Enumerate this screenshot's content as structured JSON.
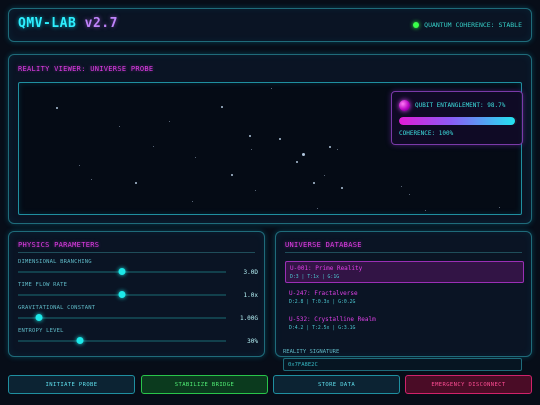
{
  "header": {
    "title": "QMV-LAB",
    "version": "v2.7",
    "status": "QUANTUM COHERENCE: STABLE",
    "status_color": "#39ff4a"
  },
  "viewer": {
    "title": "REALITY VIEWER: UNIVERSE PROBE",
    "qubit": {
      "entanglement_label": "QUBIT ENTANGLEMENT: 98.7%",
      "entanglement_fraction": 0.987,
      "coherence_label": "COHERENCE: 100%"
    }
  },
  "physics": {
    "title": "PHYSICS PARAMETERS",
    "params": [
      {
        "label": "DIMENSIONAL BRANCHING",
        "value": "3.0D",
        "fraction": 0.5
      },
      {
        "label": "TIME FLOW RATE",
        "value": "1.0x",
        "fraction": 0.5
      },
      {
        "label": "GRAVITATIONAL CONSTANT",
        "value": "1.00G",
        "fraction": 0.1
      },
      {
        "label": "ENTROPY LEVEL",
        "value": "30%",
        "fraction": 0.3
      }
    ]
  },
  "database": {
    "title": "UNIVERSE DATABASE",
    "items": [
      {
        "name": "U-001: Prime Reality",
        "meta": "D:3 | T:1x | G:1G",
        "selected": true
      },
      {
        "name": "U-247: Fractalverse",
        "meta": "D:2.8 | T:0.3x | G:0.2G",
        "selected": false
      },
      {
        "name": "U-532: Crystalline Realm",
        "meta": "D:4.2 | T:2.5x | G:3.1G",
        "selected": false
      }
    ],
    "signature_label": "REALITY SIGNATURE",
    "signature_value": "0x7FA8E2C"
  },
  "actions": {
    "probe": "INITIATE PROBE",
    "stabilize": "STABILIZE BRIDGE",
    "store": "STORE DATA",
    "emergency": "EMERGENCY DISCONNECT"
  }
}
